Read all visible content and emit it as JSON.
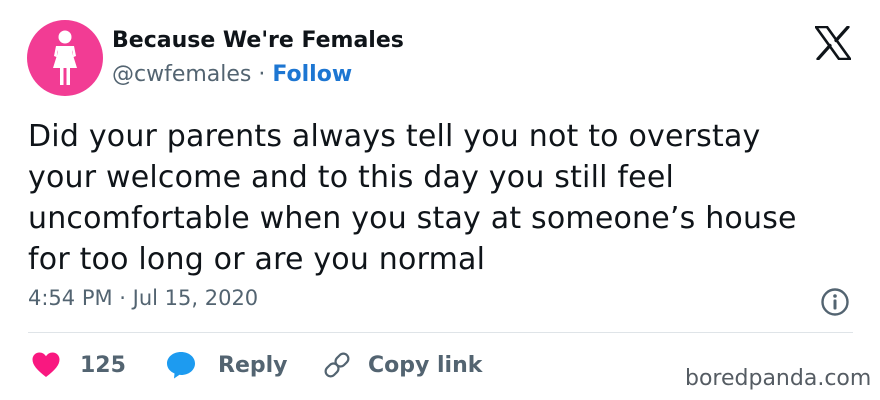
{
  "author": {
    "display_name": "Because We're Females",
    "handle": "@cwfemales",
    "separator": "·",
    "follow_label": "Follow",
    "avatar_color": "#f23c94",
    "avatar_icon": "female-figure-icon"
  },
  "platform": {
    "logo_icon": "x-logo-icon"
  },
  "tweet": {
    "lines": [
      "Did your parents always tell you not to overstay",
      "your welcome and to this day you still feel",
      "uncomfortable when you stay at someone’s house",
      "for too long or are you normal"
    ],
    "timestamp": "4:54 PM · Jul 15, 2020",
    "info_icon": "info-icon"
  },
  "actions": {
    "like_count": "125",
    "like_icon": "heart-icon",
    "like_color": "#f91880",
    "reply_label": "Reply",
    "reply_icon": "speech-bubble-icon",
    "reply_color": "#1d9bf0",
    "copy_label": "Copy link",
    "copy_icon": "link-icon"
  },
  "watermark": "boredpanda.com"
}
